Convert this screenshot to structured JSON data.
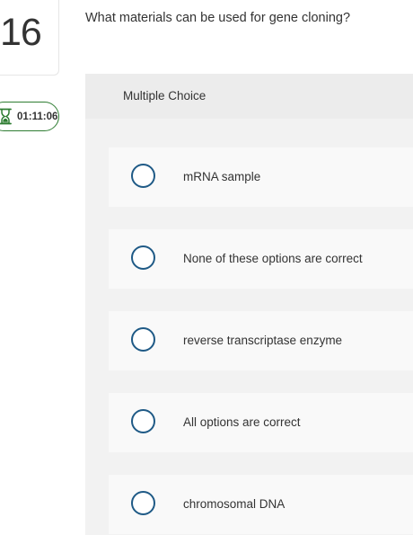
{
  "question": {
    "number": "16",
    "prompt": "What materials can be used for gene cloning?"
  },
  "timer": {
    "value": "01:11:06",
    "icon": "hourglass-icon"
  },
  "panel": {
    "title": "Multiple Choice",
    "options": [
      {
        "label": "mRNA sample",
        "selected": false
      },
      {
        "label": "None of these options are correct",
        "selected": false
      },
      {
        "label": "reverse transcriptase enzyme",
        "selected": false
      },
      {
        "label": "All options are correct",
        "selected": false
      },
      {
        "label": "chromosomal DNA",
        "selected": false
      }
    ]
  },
  "colors": {
    "timer_border": "#2e7d32",
    "radio_border": "#1f5a86",
    "panel_bg": "#f2f2f2",
    "option_bg": "#f9f9f9"
  }
}
